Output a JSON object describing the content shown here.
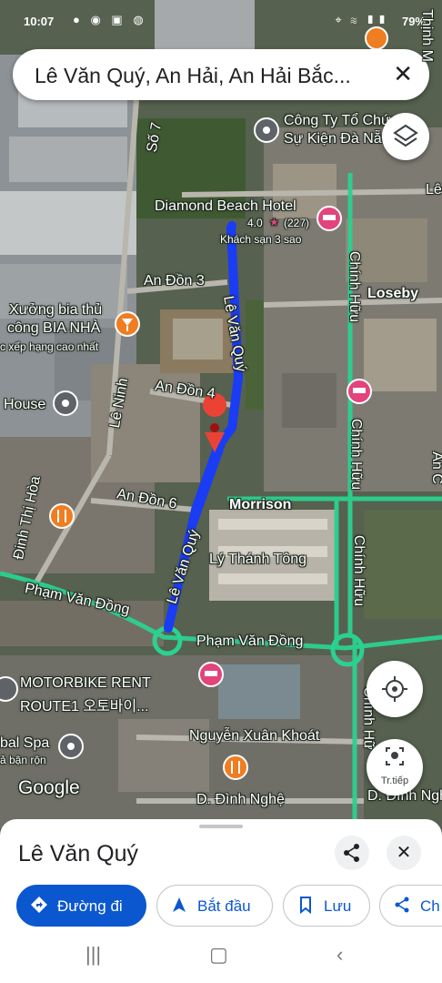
{
  "status_bar": {
    "time": "10:07",
    "battery": "79%"
  },
  "search": {
    "query": "Lê Văn Quý, An Hải, An Hải Bắc..."
  },
  "map": {
    "labels": {
      "so7": "Số 7",
      "company": "Công Ty Tổ Chức",
      "company2": "Sự Kiện Đà Nẵ",
      "hotel": "Diamond Beach Hotel",
      "hotel_rating": "4.0",
      "hotel_reviews": "(227)",
      "hotel_type": "Khách sạn 3 sao",
      "an_don_3": "An Đồn 3",
      "xuong_bia": "Xưởng bia thủ",
      "xuong_bia2": "công BIA NHÀ",
      "xep_hang": "c xếp hạng cao nhất",
      "le_van_quy_top": "Lê Văn Quý",
      "chinh_huu_1": "Chính Hữu",
      "loseby": "Loseby",
      "an_don_4": "An Đồn 4",
      "house": "House",
      "le_ninh": "Lê Ninh",
      "chinh_huu_2": "Chính Hữu",
      "an_don_6": "An Đồn 6",
      "morrison": "Morrison",
      "dinh_thi_hoa": "Đinh Thị Hòa",
      "ly_thanh_tong": "Lý Thánh Tông",
      "le_van_quy_bottom": "Lê Văn Quý",
      "chinh_huu_3": "Chính Hữu",
      "pham_van_dong_1": "Phạm Văn Đồng",
      "pham_van_dong_2": "Phạm Văn Đồng",
      "motorbike": "MOTORBIKE RENT",
      "motorbike2": "ROUTE1 오토바이...",
      "spa": "bal Spa",
      "spa2": "ả bận rộn",
      "nguyen_xuan_khoat": "Nguyễn Xuân Khoát",
      "google": "Google",
      "d_dinh_nghe": "D. Đình Nghệ",
      "d_dinh_ngh_right": "D. Đình Ngh",
      "le_right": "Lê",
      "thinh_m": "Thịnh M",
      "an_c": "An C",
      "chinh_huu_4": "Chính Hữ"
    },
    "directions_button": {
      "label": "Tr.tiếp"
    },
    "route_color": "#1a3cf5"
  },
  "place_sheet": {
    "title": "Lê Văn Quý",
    "actions": [
      "Đường đi",
      "Bắt đầu",
      "Lưu",
      "Ch"
    ]
  }
}
